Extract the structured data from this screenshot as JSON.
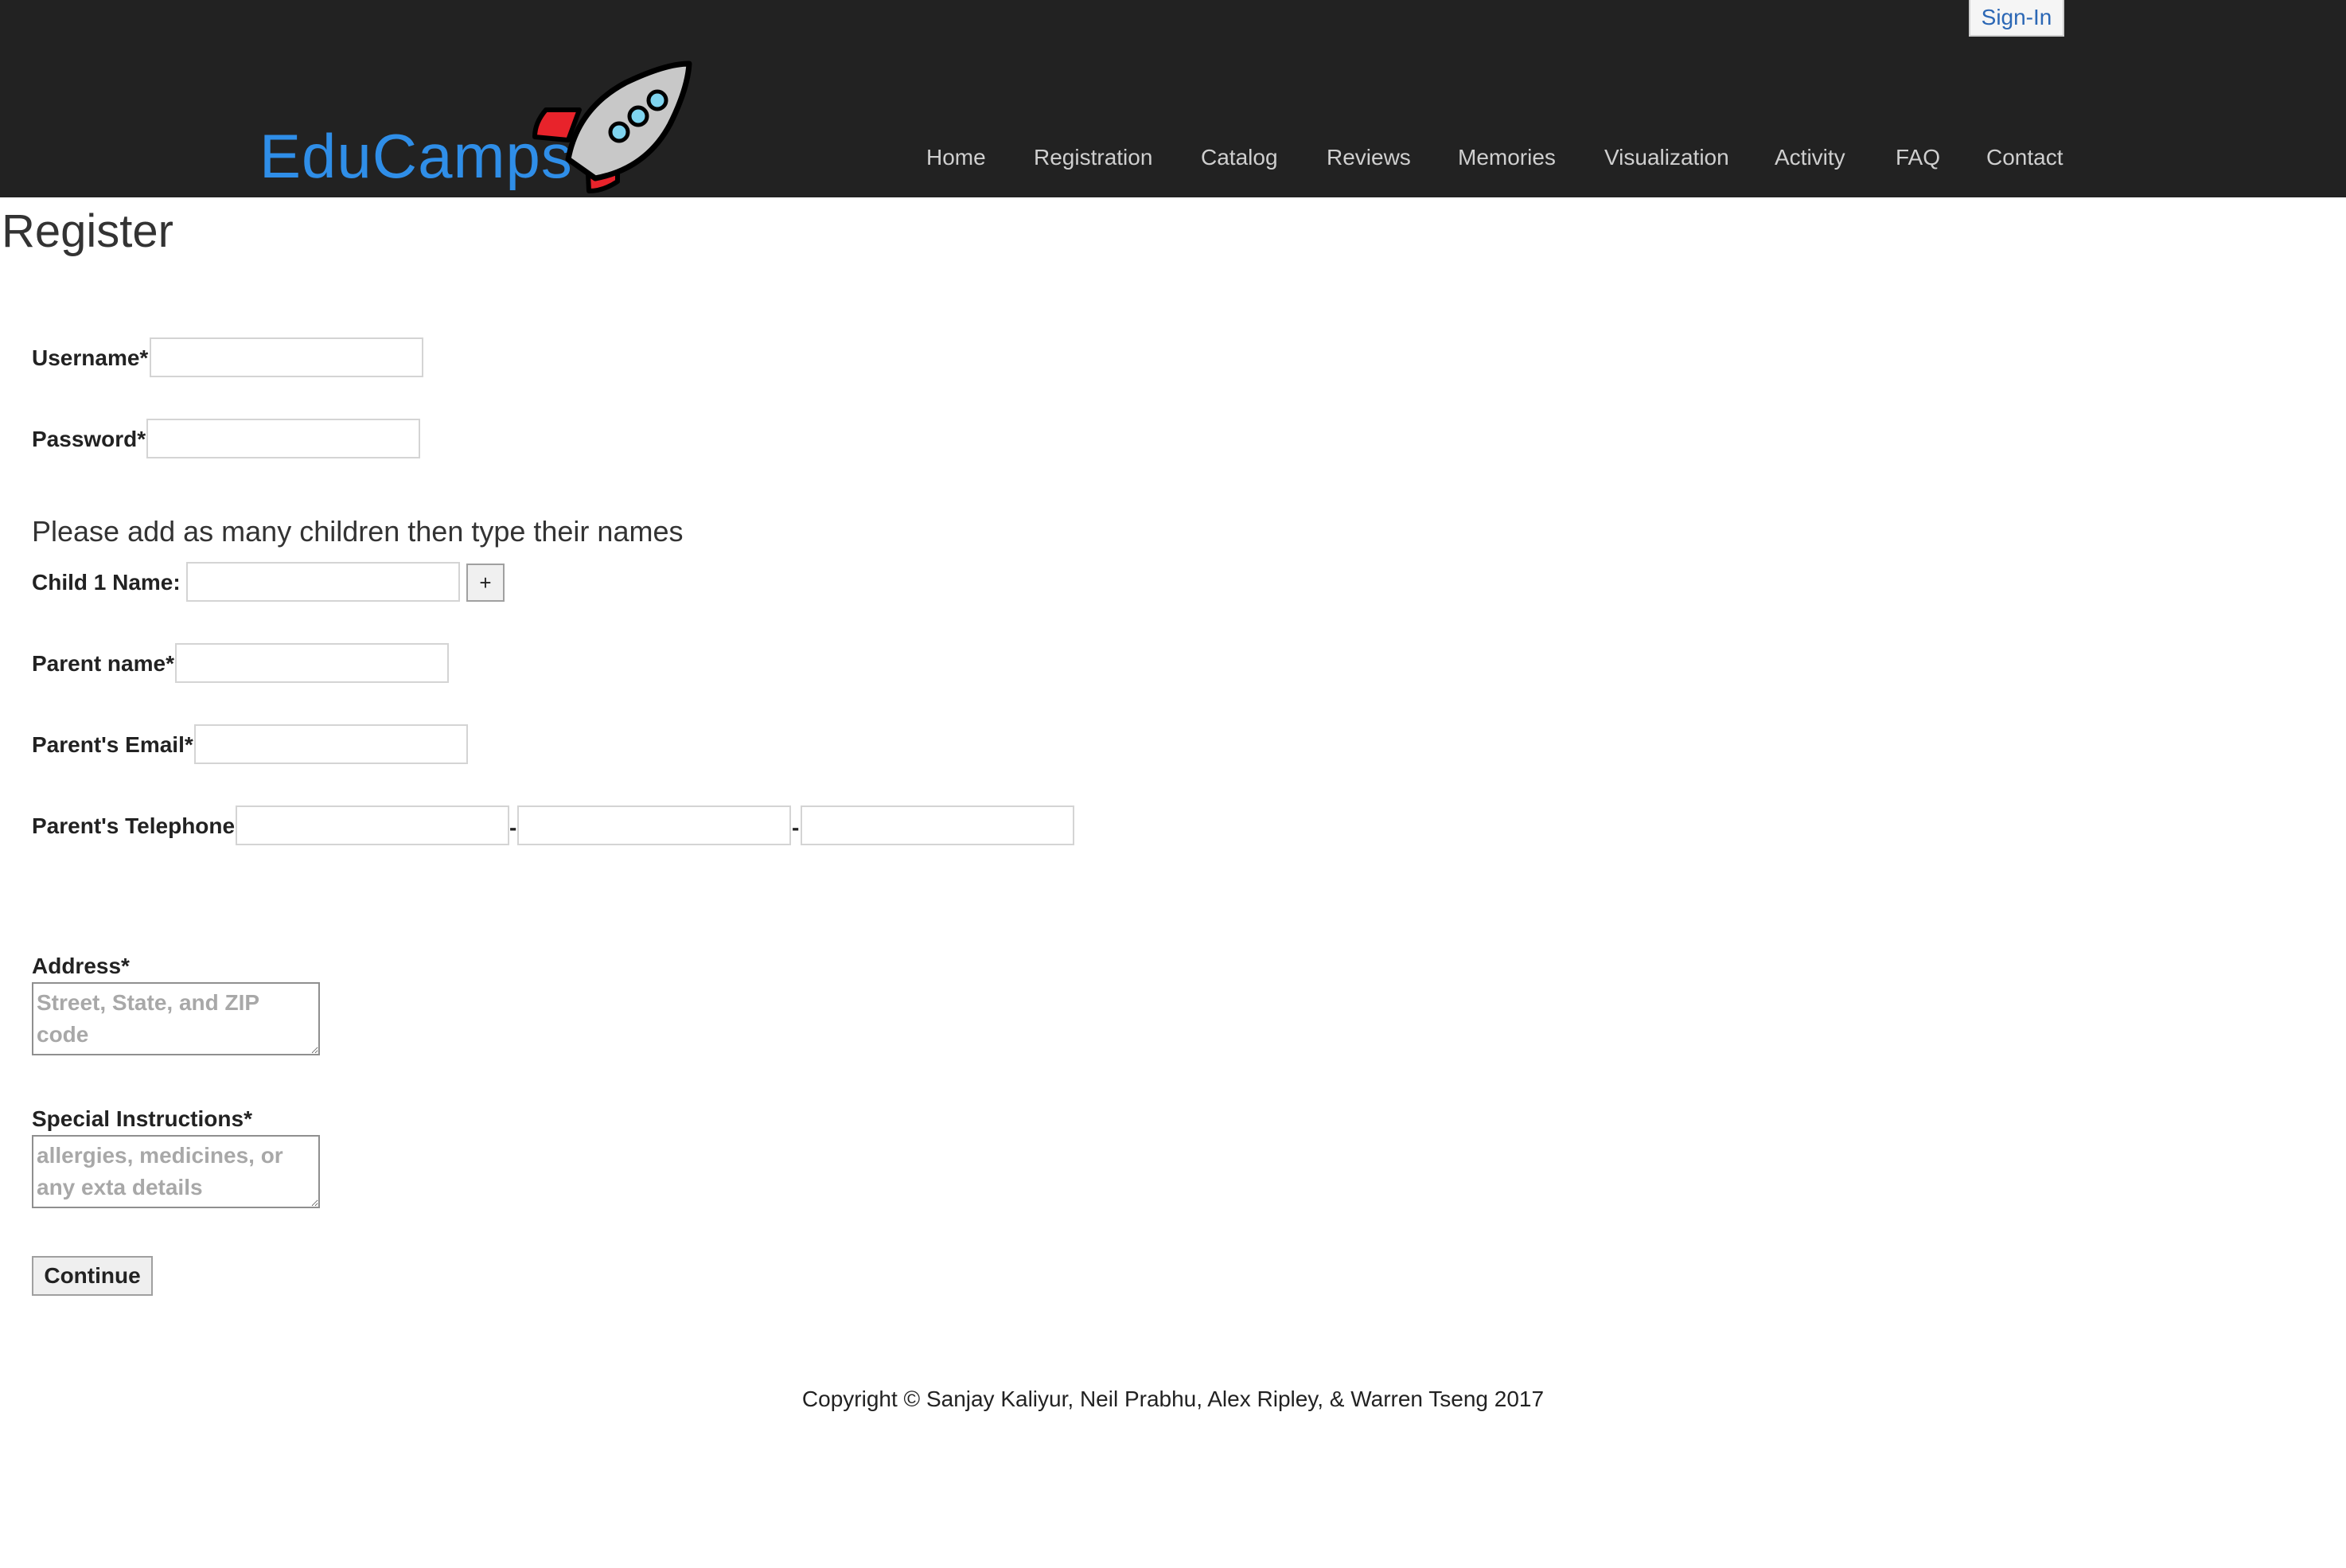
{
  "header": {
    "signin_label": "Sign-In",
    "logo_text": "EduCamps",
    "nav": [
      {
        "label": "Home"
      },
      {
        "label": "Registration"
      },
      {
        "label": "Catalog"
      },
      {
        "label": "Reviews"
      },
      {
        "label": "Memories"
      },
      {
        "label": "Visualization"
      },
      {
        "label": "Activity"
      },
      {
        "label": "FAQ"
      },
      {
        "label": "Contact"
      }
    ]
  },
  "form": {
    "title": "Register",
    "username_label": "Username*",
    "password_label": "Password*",
    "children_heading": "Please add as many children then type their names",
    "child_label": "Child 1 Name:",
    "add_child_label": "+",
    "parent_name_label": "Parent name*",
    "parent_email_label": "Parent's Email*",
    "parent_phone_label": "Parent's Telephone",
    "phone_separator": "-",
    "address_label": "Address*",
    "address_placeholder": "Street, State, and ZIP code",
    "instructions_label": "Special Instructions*",
    "instructions_placeholder": "allergies, medicines, or any exta details",
    "continue_label": "Continue"
  },
  "footer": {
    "copyright": "Copyright © Sanjay Kaliyur, Neil Prabhu, Alex Ripley, & Warren Tseng 2017"
  },
  "colors": {
    "header_bg": "#222222",
    "nav_text": "#cfcfcf",
    "logo_blue": "#2f8ee8",
    "link_blue": "#2b67b5"
  }
}
